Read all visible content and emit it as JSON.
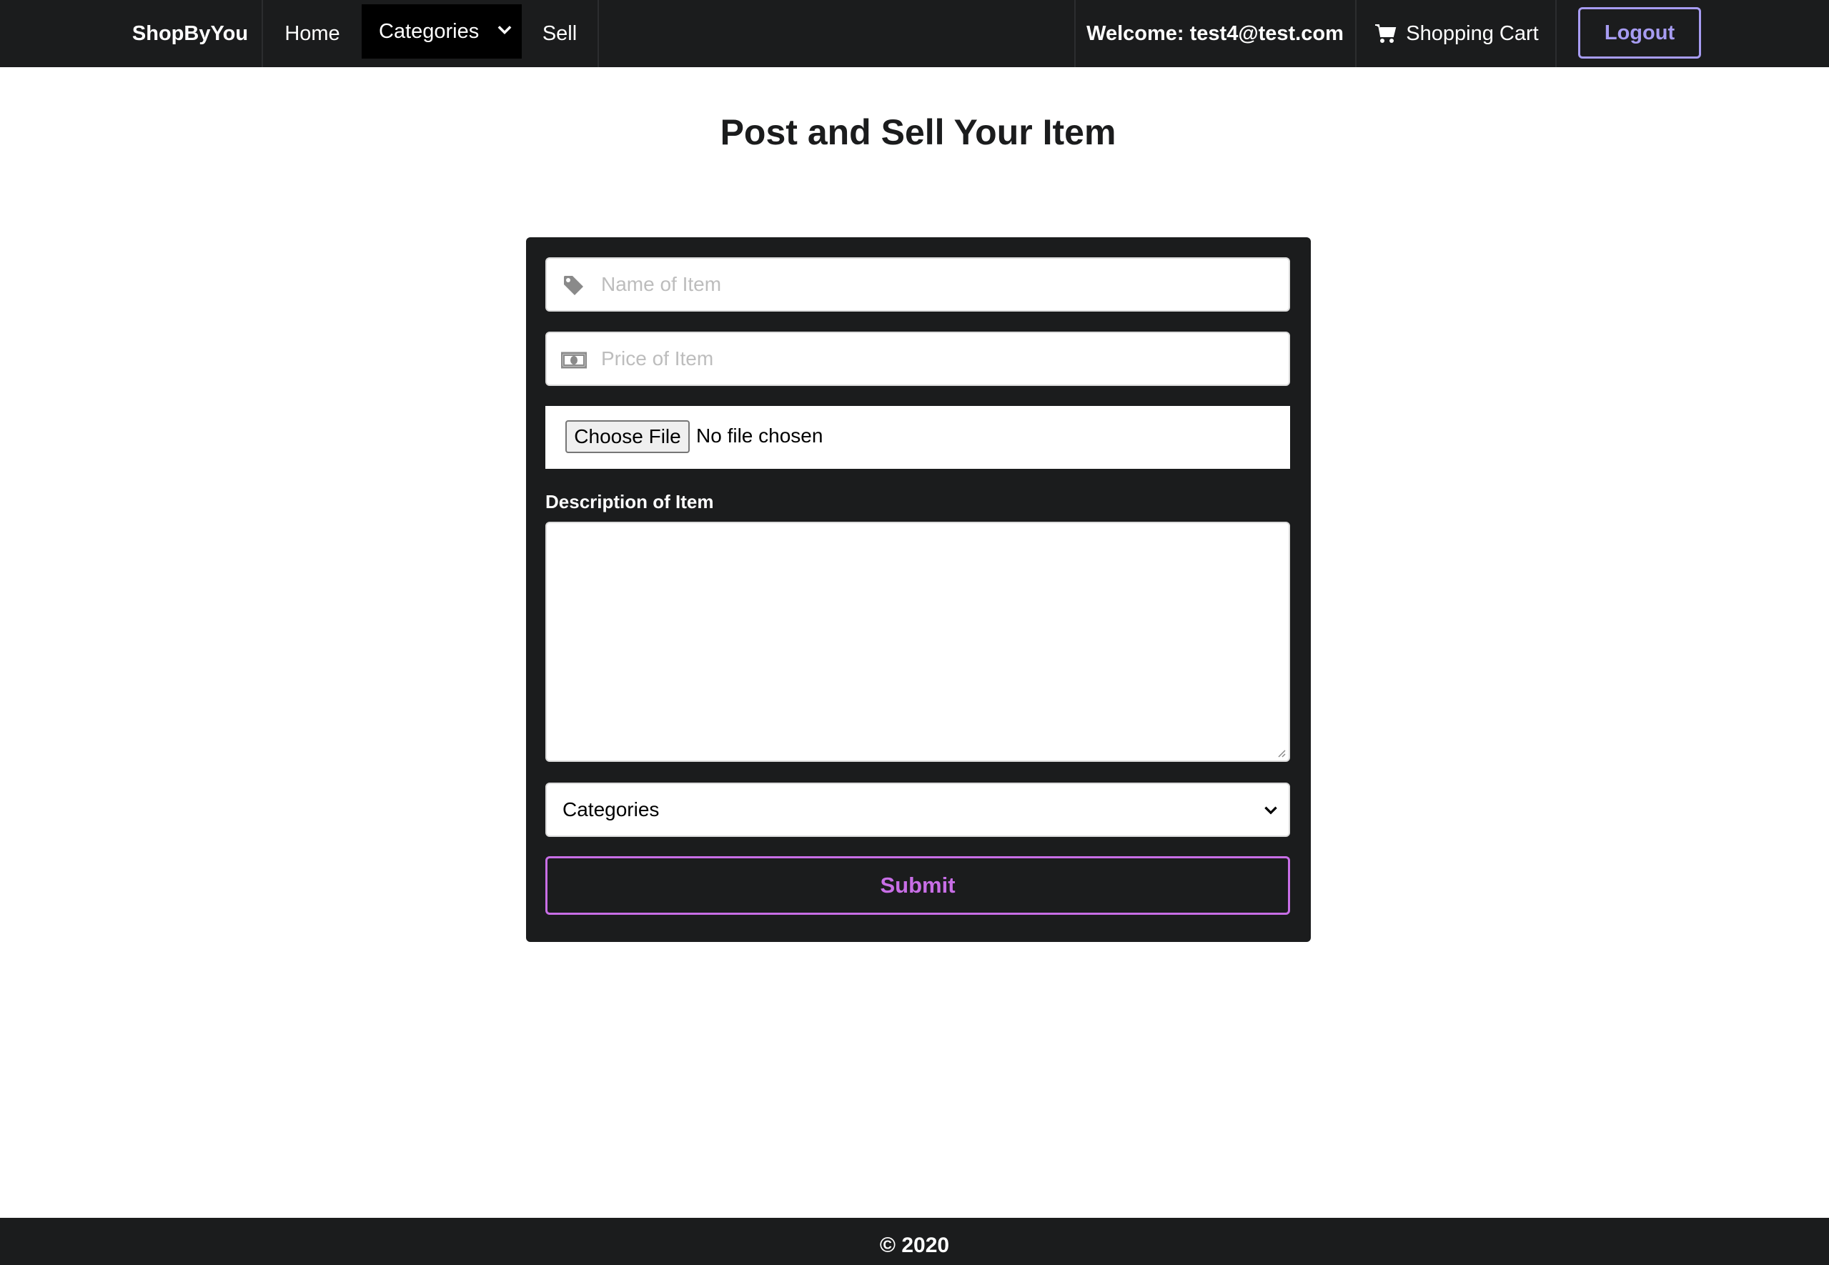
{
  "nav": {
    "brand": "ShopByYou",
    "home": "Home",
    "categories": "Categories",
    "sell": "Sell",
    "welcome": "Welcome: test4@test.com",
    "cart": "Shopping Cart",
    "logout": "Logout"
  },
  "page": {
    "title": "Post and Sell Your Item"
  },
  "form": {
    "name_placeholder": "Name of Item",
    "price_placeholder": "Price of Item",
    "file_button": "Choose File",
    "file_status": "No file chosen",
    "description_label": "Description of Item",
    "description_value": "",
    "category_selected": "Categories",
    "submit": "Submit"
  },
  "footer": {
    "copyright": "© 2020"
  },
  "colors": {
    "nav_bg": "#1b1c1d",
    "logout_accent": "#a79cf2",
    "submit_accent": "#c86ee6"
  },
  "icons": {
    "name_field": "tag-icon",
    "price_field": "money-bill-icon",
    "cart": "cart-icon",
    "dropdown": "chevron-down-icon"
  }
}
